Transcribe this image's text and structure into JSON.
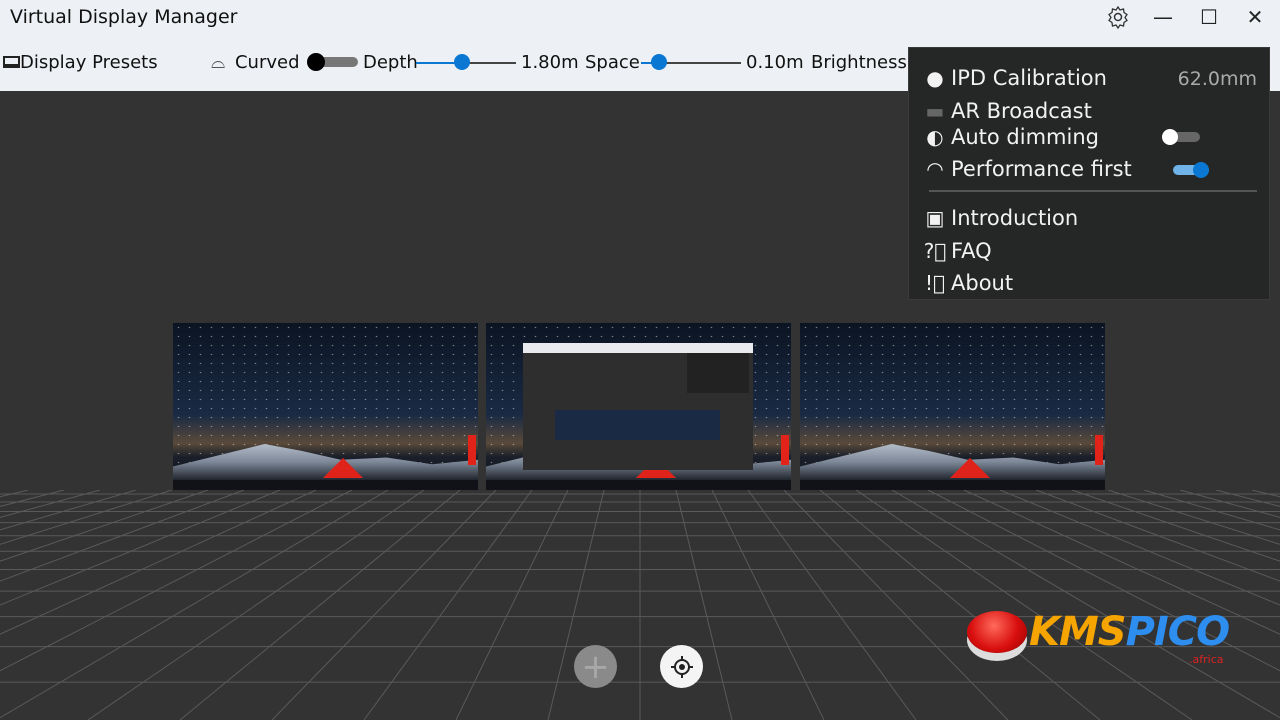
{
  "window": {
    "title": "Virtual Display Manager",
    "settings_icon": "gear-icon",
    "minimize": "—",
    "maximize": "☐",
    "close": "✕"
  },
  "toolbar": {
    "presets_label": "Display Presets",
    "curved_label": "Curved",
    "curved_on": false,
    "depth_label": "Depth",
    "depth_value": "1.80m",
    "depth_fraction": 0.45,
    "space_label": "Space",
    "space_value": "0.10m",
    "space_fraction": 0.2,
    "brightness_label": "Brightness"
  },
  "menu": {
    "ipd_label": "IPD Calibration",
    "ipd_value": "62.0mm",
    "ar_label": "AR Broadcast",
    "dimming_label": "Auto dimming",
    "dimming_on": false,
    "performance_label": "Performance first",
    "performance_on": true,
    "intro_label": "Introduction",
    "faq_label": "FAQ",
    "about_label": "About"
  },
  "screens": [
    "display-left",
    "display-center",
    "display-right"
  ],
  "controls": {
    "add": "+",
    "recenter": "crosshair-icon"
  },
  "watermark": {
    "text": "KMSPICO",
    "sub": ".africa"
  },
  "colors": {
    "accent": "#0a78d2",
    "background": "#333333",
    "toolbar": "#edf0f4",
    "menu": "#252626"
  }
}
